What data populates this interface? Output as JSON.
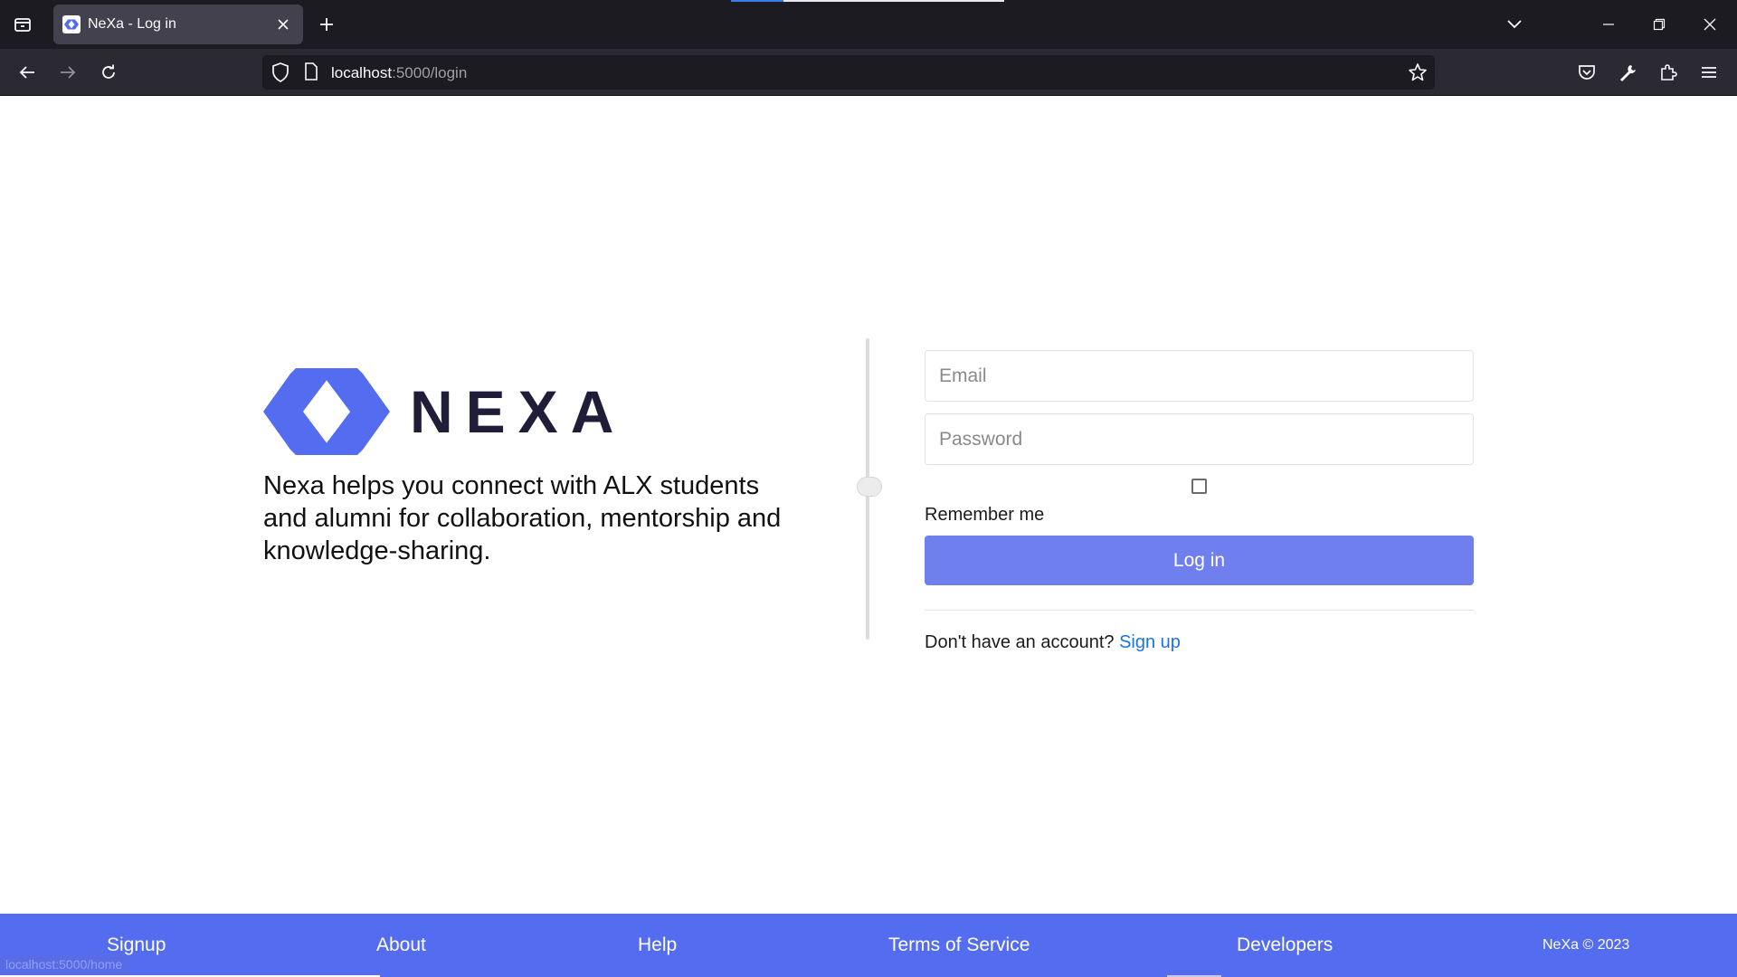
{
  "browser": {
    "tab_title": "NeXa - Log in",
    "url_host": "localhost",
    "url_path": ":5000/login",
    "icons": {
      "tab_list": "tab-list-icon",
      "new_tab": "plus-icon",
      "list_all_tabs": "chevron-down-icon",
      "minimize": "minimize-icon",
      "restore": "restore-icon",
      "close_window": "close-icon",
      "back": "back-arrow-icon",
      "forward": "forward-arrow-icon",
      "reload": "reload-icon",
      "shield": "shield-icon",
      "page": "page-icon",
      "bookmark": "star-icon",
      "pocket": "pocket-icon",
      "tools": "wrench-icon",
      "extensions": "puzzle-icon",
      "menu": "hamburger-menu-icon"
    }
  },
  "brand": {
    "logo_text": "NEXA",
    "tagline": "Nexa helps you connect with ALX students and alumni for collaboration, mentorship and knowledge-sharing.",
    "accent_color": "#546cef"
  },
  "login_form": {
    "email_placeholder": "Email",
    "email_value": "",
    "password_placeholder": "Password",
    "password_value": "",
    "remember_checked": false,
    "remember_label": "Remember me",
    "submit_label": "Log in",
    "submit_color": "#6f80ee",
    "signup_prompt": "Don't have an account?",
    "signup_link": "Sign up"
  },
  "footer": {
    "links": [
      "Signup",
      "About",
      "Help",
      "Terms of Service",
      "Developers"
    ],
    "copyright": "NeXa © 2023"
  },
  "status_bar": {
    "hover_url": "localhost:5000/home"
  }
}
